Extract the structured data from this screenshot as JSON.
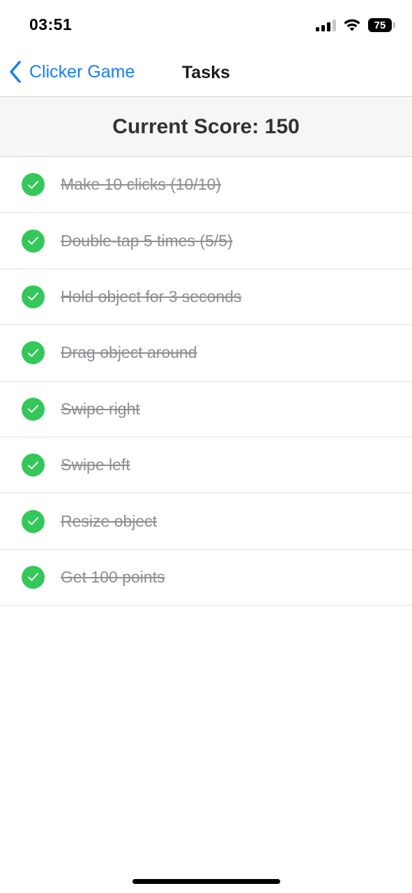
{
  "status_bar": {
    "time": "03:51",
    "battery": "75",
    "icons": [
      "signal-icon",
      "wifi-icon",
      "battery-icon"
    ]
  },
  "nav": {
    "back_label": "Clicker Game",
    "title": "Tasks",
    "back_icon": "chevron-left-icon"
  },
  "score": {
    "text": "Current Score: 150"
  },
  "tasks": [
    {
      "label": "Make 10 clicks (10/10)",
      "completed": true
    },
    {
      "label": "Double-tap 5 times (5/5)",
      "completed": true
    },
    {
      "label": "Hold object for 3 seconds",
      "completed": true
    },
    {
      "label": "Drag object around",
      "completed": true
    },
    {
      "label": "Swipe right",
      "completed": true
    },
    {
      "label": "Swipe left",
      "completed": true
    },
    {
      "label": "Resize object",
      "completed": true
    },
    {
      "label": "Get 100 points",
      "completed": true
    }
  ],
  "colors": {
    "accent": "#1a7ff0",
    "check": "#34c759",
    "completed_text": "#8e8e93",
    "header_bg": "#f6f6f6"
  }
}
